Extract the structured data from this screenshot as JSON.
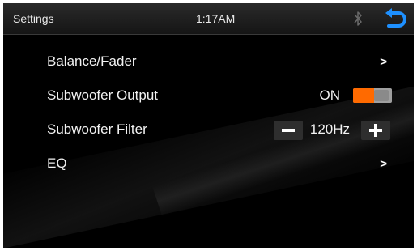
{
  "status_bar": {
    "title": "Settings",
    "time": "1:17AM",
    "bluetooth_icon": "bluetooth-icon",
    "back_icon": "back-arrow-icon",
    "accent_color": "#1e90ff"
  },
  "menu": {
    "items": [
      {
        "label": "Balance/Fader",
        "trailing": "chevron-right-icon"
      },
      {
        "label": "Subwoofer Output",
        "state_label": "ON",
        "toggle_on": true,
        "toggle_color": "#ff6a00"
      },
      {
        "label": "Subwoofer Filter",
        "value": "120Hz",
        "decrement_icon": "minus-icon",
        "increment_icon": "plus-icon"
      },
      {
        "label": "EQ",
        "trailing": "chevron-right-icon"
      }
    ]
  }
}
